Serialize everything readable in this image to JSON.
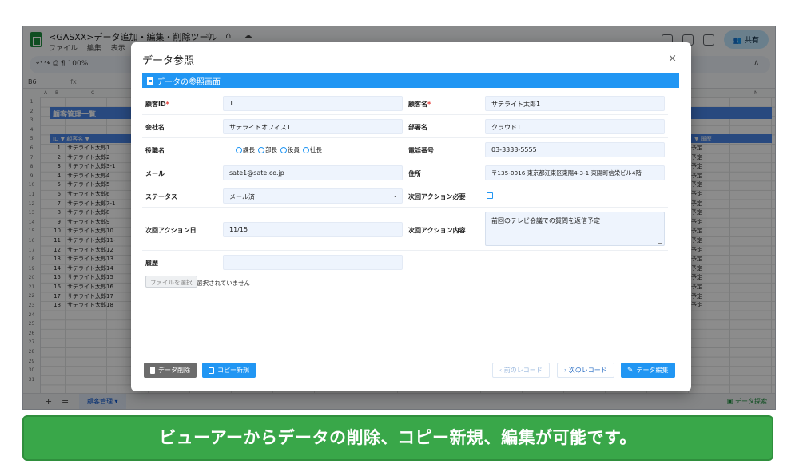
{
  "spreadsheet": {
    "doc_title": "<GASXX>データ追加・編集・削除ツール",
    "menu": [
      "ファイル",
      "編集",
      "表示",
      "挿入"
    ],
    "share_label": "共有",
    "zoom": "100%",
    "cell_ref": "B6",
    "fx": "fx",
    "sheet_heading": "顧客管理一覧",
    "table_header": "ID ▼ 顧客名 ▼",
    "right_header": "▼ 履歴",
    "column_letters": [
      "A",
      "B",
      "C",
      "N"
    ],
    "row_numbers": [
      "1",
      "2",
      "3",
      "4",
      "5",
      "6",
      "7",
      "8",
      "9",
      "10",
      "11",
      "12",
      "13",
      "14",
      "15",
      "16",
      "17",
      "18",
      "19",
      "20",
      "21",
      "22",
      "23",
      "24",
      "25",
      "26",
      "27",
      "28",
      "29",
      "30",
      "31"
    ],
    "rows": [
      {
        "id": "1",
        "name": "サテライト太郎1"
      },
      {
        "id": "2",
        "name": "サテライト太郎2"
      },
      {
        "id": "3",
        "name": "サテライト太郎3-1"
      },
      {
        "id": "4",
        "name": "サテライト太郎4"
      },
      {
        "id": "5",
        "name": "サテライト太郎5"
      },
      {
        "id": "6",
        "name": "サテライト太郎6"
      },
      {
        "id": "7",
        "name": "サテライト太郎7-1"
      },
      {
        "id": "8",
        "name": "サテライト太郎8"
      },
      {
        "id": "9",
        "name": "サテライト太郎9"
      },
      {
        "id": "10",
        "name": "サテライト太郎10"
      },
      {
        "id": "11",
        "name": "サテライト太郎11-"
      },
      {
        "id": "12",
        "name": "サテライト太郎12"
      },
      {
        "id": "13",
        "name": "サテライト太郎13"
      },
      {
        "id": "14",
        "name": "サテライト太郎14"
      },
      {
        "id": "15",
        "name": "サテライト太郎15"
      },
      {
        "id": "16",
        "name": "サテライト太郎16"
      },
      {
        "id": "17",
        "name": "サテライト太郎17"
      },
      {
        "id": "18",
        "name": "サテライト太郎18"
      }
    ],
    "right_col_value": "予定",
    "sheet_tab": "顧客管理 ▾",
    "explore_label": "データ探索"
  },
  "modal": {
    "title": "データ参照",
    "close": "×",
    "section_title": "データの参照画面",
    "fields": {
      "customer_id_label": "顧客ID",
      "customer_id_value": "1",
      "customer_name_label": "顧客名",
      "customer_name_value": "サテライト太郎1",
      "company_label": "会社名",
      "company_value": "サテライトオフィス1",
      "department_label": "部署名",
      "department_value": "クラウド1",
      "position_label": "役職名",
      "position_options": [
        "課長",
        "部長",
        "役員",
        "社長"
      ],
      "phone_label": "電話番号",
      "phone_value": "03-3333-5555",
      "email_label": "メール",
      "email_value": "sate1@sate.co.jp",
      "address_label": "住所",
      "address_value": "〒135-0016 東京都江東区東陽4-3-1 東陽町信栄ビル4階",
      "status_label": "ステータス",
      "status_value": "メール済",
      "next_action_required_label": "次回アクション必要",
      "next_action_date_label": "次回アクション日",
      "next_action_date_value": "11/15",
      "next_action_content_label": "次回アクション内容",
      "next_action_content_value": "前回のテレビ会議での質問を返信予定",
      "history_label": "履歴",
      "history_value": ""
    },
    "required_mark": "*",
    "file_button": "ファイルを選択",
    "file_status": "選択されていません",
    "buttons": {
      "delete": "データ削除",
      "copy_new": "コピー新規",
      "prev": "‹ 前のレコード",
      "next": "› 次のレコード",
      "edit": "データ編集"
    },
    "colors": {
      "accent": "#2196f3",
      "delete": "#6c6c6c"
    }
  },
  "banner": {
    "text": "ビューアーからデータの削除、コピー新規、編集が可能です。",
    "color": "#39a749"
  }
}
